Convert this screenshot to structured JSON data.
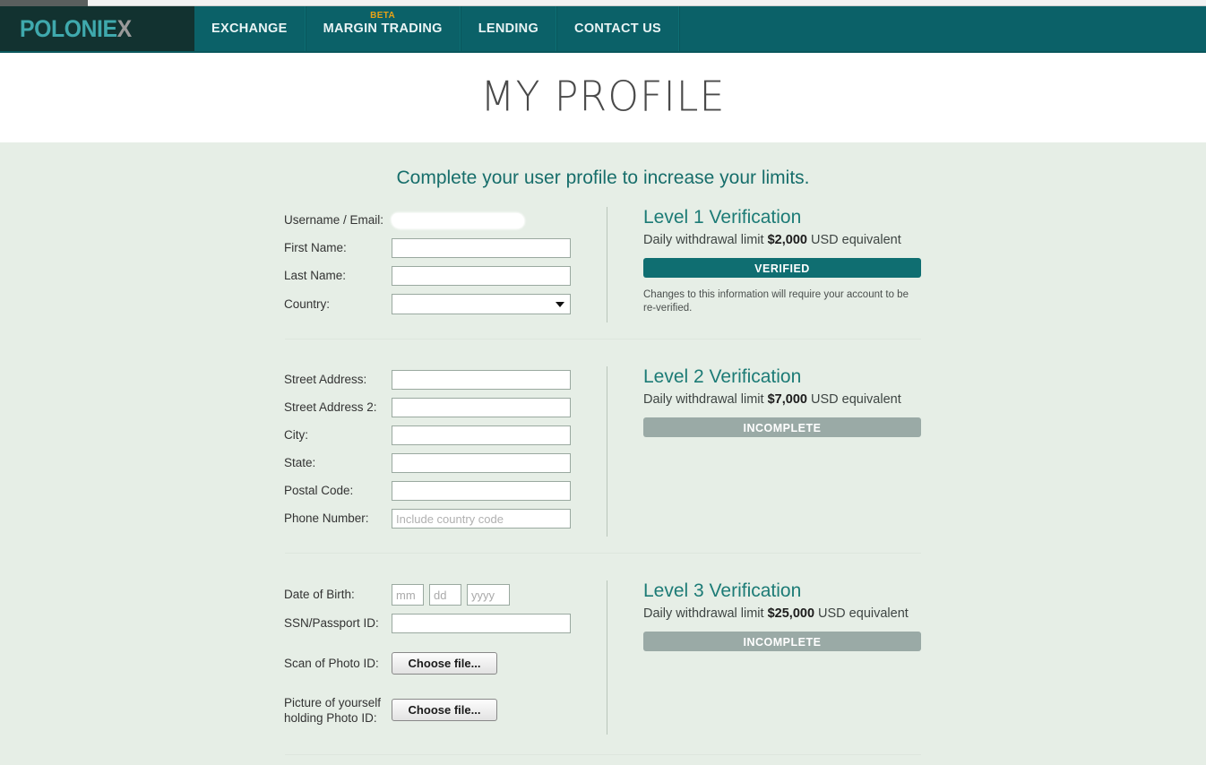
{
  "nav": {
    "brand_main": "POLONIE",
    "brand_accent": "X",
    "items": [
      {
        "label": "EXCHANGE",
        "badge": null
      },
      {
        "label": "MARGIN TRADING",
        "badge": "BETA"
      },
      {
        "label": "LENDING",
        "badge": null
      },
      {
        "label": "CONTACT US",
        "badge": null
      }
    ]
  },
  "page": {
    "title": "MY PROFILE",
    "subtitle": "Complete your user profile to increase your limits."
  },
  "sections": {
    "identity": {
      "fields": {
        "username_label": "Username / Email:",
        "username_value": "",
        "first_name_label": "First Name:",
        "first_name_value": "",
        "last_name_label": "Last Name:",
        "last_name_value": "",
        "country_label": "Country:",
        "country_value": ""
      }
    },
    "address": {
      "fields": {
        "street_label": "Street Address:",
        "street_value": "",
        "street2_label": "Street Address 2:",
        "street2_value": "",
        "city_label": "City:",
        "city_value": "",
        "state_label": "State:",
        "state_value": "",
        "postal_label": "Postal Code:",
        "postal_value": "",
        "phone_label": "Phone Number:",
        "phone_value": "",
        "phone_placeholder": "Include country code"
      }
    },
    "documents": {
      "fields": {
        "dob_label": "Date of Birth:",
        "dob_mm_placeholder": "mm",
        "dob_dd_placeholder": "dd",
        "dob_yyyy_placeholder": "yyyy",
        "dob_mm_value": "",
        "dob_dd_value": "",
        "dob_yyyy_value": "",
        "ssn_label": "SSN/Passport ID:",
        "ssn_value": "",
        "scan_label": "Scan of Photo ID:",
        "scan_button": "Choose file...",
        "selfie_label": "Picture of yourself holding Photo ID:",
        "selfie_button": "Choose file..."
      }
    }
  },
  "levels": [
    {
      "title": "Level 1 Verification",
      "limit_prefix": "Daily withdrawal limit ",
      "limit_amount": "$2,000",
      "limit_suffix": " USD equivalent",
      "status": "VERIFIED",
      "status_kind": "verified",
      "note": "Changes to this information will require your account to be re-verified."
    },
    {
      "title": "Level 2 Verification",
      "limit_prefix": "Daily withdrawal limit ",
      "limit_amount": "$7,000",
      "limit_suffix": " USD equivalent",
      "status": "INCOMPLETE",
      "status_kind": "incomplete",
      "note": ""
    },
    {
      "title": "Level 3 Verification",
      "limit_prefix": "Daily withdrawal limit ",
      "limit_amount": "$25,000",
      "limit_suffix": " USD equivalent",
      "status": "INCOMPLETE",
      "status_kind": "incomplete",
      "note": ""
    }
  ],
  "colors": {
    "nav_bg": "#0b6168",
    "brand_bg": "#123230",
    "brand_teal": "#3fa9ad",
    "brand_gray": "#9a9a9a",
    "beta_gold": "#e8a317",
    "page_bg": "#e6eee6",
    "heading_teal": "#1c7b76",
    "verified_bg": "#0f6e71",
    "incomplete_bg": "#9aaaa6"
  }
}
